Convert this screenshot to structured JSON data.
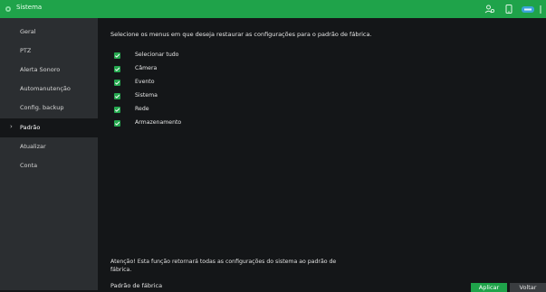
{
  "titlebar": {
    "title": "Sistema"
  },
  "sidebar": {
    "items": [
      {
        "label": "Geral"
      },
      {
        "label": "PTZ"
      },
      {
        "label": "Alerta Sonoro"
      },
      {
        "label": "Automanutenção"
      },
      {
        "label": "Config. backup"
      },
      {
        "label": "Padrão"
      },
      {
        "label": "Atualizar"
      },
      {
        "label": "Conta"
      }
    ],
    "active_index": 5
  },
  "main": {
    "instruction": "Selecione os menus em que deseja restaurar as configurações para o padrão de fábrica.",
    "options": [
      {
        "label": "Selecionar tudo",
        "checked": true
      },
      {
        "label": "Câmera",
        "checked": true
      },
      {
        "label": "Evento",
        "checked": true
      },
      {
        "label": "Sistema",
        "checked": true
      },
      {
        "label": "Rede",
        "checked": true
      },
      {
        "label": "Armazenamento",
        "checked": true
      }
    ],
    "warning": "Atenção! Esta função retornará todas as configurações do sistema ao padrão de fábrica.",
    "footer_label": "Padrão de fábrica",
    "apply_label": "Aplicar",
    "back_label": "Voltar"
  },
  "colors": {
    "accent": "#1fa34a",
    "sidebar": "#2b2e31",
    "background": "#141618"
  },
  "icons": [
    "users-icon",
    "phone-icon",
    "network-icon",
    "window-control-icon"
  ]
}
